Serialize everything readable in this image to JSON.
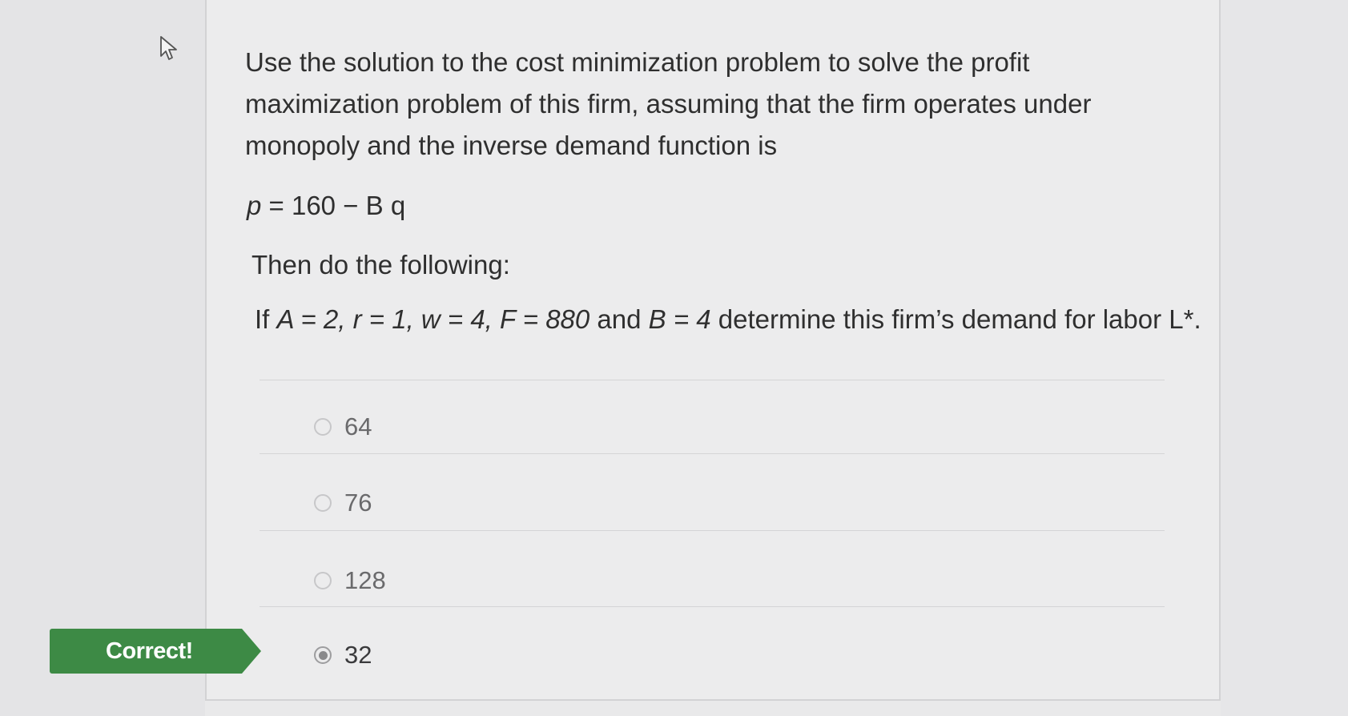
{
  "question": {
    "text": "Use the solution to the cost minimization problem to solve the profit maximization problem of this firm, assuming that the firm operates under monopoly and the inverse demand function is",
    "formula": {
      "lhs": "p",
      "rhs": " = 160 − B q"
    },
    "instruction": "Then do the following:",
    "prompt": {
      "prefix": "If ",
      "params": "A = 2, r = 1, w = 4, F = 880",
      "middle": " and ",
      "param_b": "B = 4",
      "suffix": " determine this firm’s demand for labor L*."
    }
  },
  "answers": [
    {
      "label": "64",
      "selected": false
    },
    {
      "label": "76",
      "selected": false
    },
    {
      "label": "128",
      "selected": false
    },
    {
      "label": "32",
      "selected": true
    }
  ],
  "feedback": {
    "label": "Correct!",
    "color": "#3d8a45"
  },
  "icons": {
    "cursor": "mouse-pointer-icon",
    "radio": "radio-button-icon"
  }
}
